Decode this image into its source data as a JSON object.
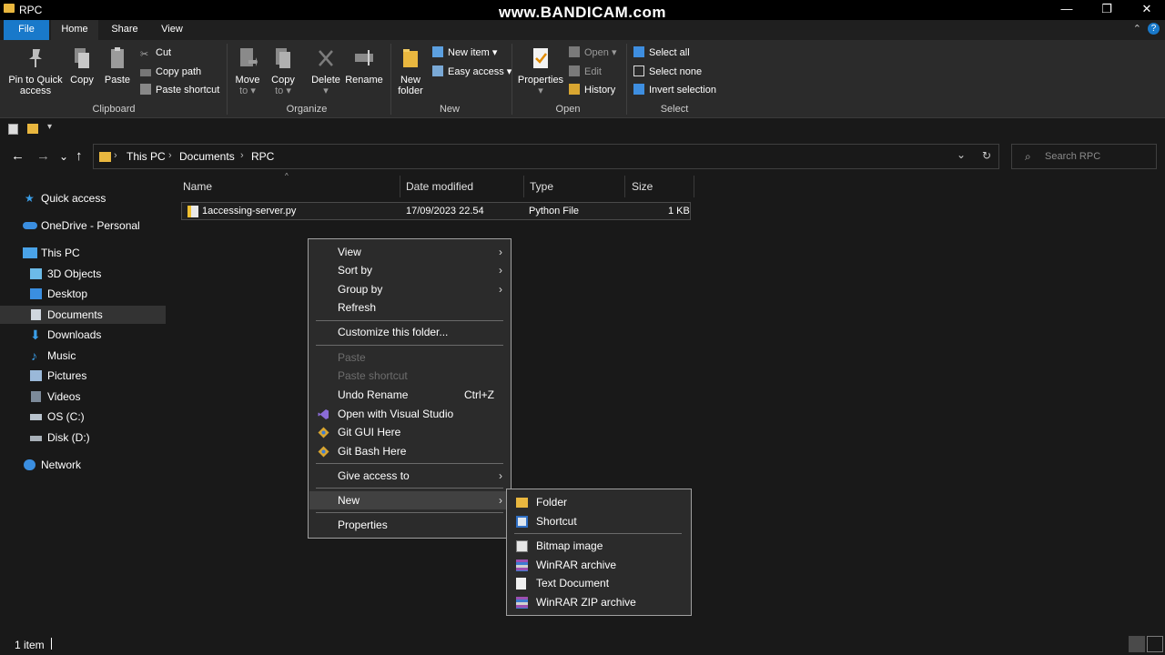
{
  "window": {
    "title": "RPC",
    "watermark": "www.BANDICAM.com",
    "minimize_glyph": "—",
    "restore_glyph": "❐",
    "close_glyph": "✕"
  },
  "tabs": {
    "file": "File",
    "home": "Home",
    "share": "Share",
    "view": "View",
    "collapse_glyph": "⌃",
    "help_glyph": "?"
  },
  "ribbon": {
    "clipboard": {
      "label": "Clipboard",
      "pin_line1": "Pin to Quick",
      "pin_line2": "access",
      "copy": "Copy",
      "paste": "Paste",
      "cut": "Cut",
      "copy_path": "Copy path",
      "paste_shortcut": "Paste shortcut"
    },
    "organize": {
      "label": "Organize",
      "move_line1": "Move",
      "move_line2": "to ▾",
      "copy_line1": "Copy",
      "copy_line2": "to ▾",
      "delete_line1": "Delete",
      "delete_line2": "▾",
      "rename": "Rename"
    },
    "new": {
      "label": "New",
      "folder_line1": "New",
      "folder_line2": "folder",
      "new_item": "New item ▾",
      "easy_access": "Easy access ▾"
    },
    "open": {
      "label": "Open",
      "properties_line1": "Properties",
      "properties_line2": "▾",
      "open": "Open ▾",
      "edit": "Edit",
      "history": "History"
    },
    "select": {
      "label": "Select",
      "select_all": "Select all",
      "select_none": "Select none",
      "invert": "Invert selection"
    }
  },
  "qat": {
    "dropdown_glyph": "▾"
  },
  "address": {
    "back": "←",
    "forward": "→",
    "recent": "⌄",
    "up": "↑",
    "crumbs": [
      "This PC",
      "Documents",
      "RPC"
    ],
    "crumb_sep": "›",
    "dropdown": "⌄",
    "refresh": "↻"
  },
  "search": {
    "placeholder": "Search RPC",
    "glyph": "⌕"
  },
  "nav": {
    "quick_access": "Quick access",
    "onedrive": "OneDrive - Personal",
    "this_pc": "This PC",
    "objects3d": "3D Objects",
    "desktop": "Desktop",
    "documents": "Documents",
    "downloads": "Downloads",
    "music": "Music",
    "pictures": "Pictures",
    "videos": "Videos",
    "os": "OS (C:)",
    "disk": "Disk (D:)",
    "network": "Network"
  },
  "columns": {
    "name": "Name",
    "date": "Date modified",
    "type": "Type",
    "size": "Size",
    "sort_glyph": "^"
  },
  "files": [
    {
      "name": "1accessing-server.py",
      "date": "17/09/2023 22.54",
      "type": "Python File",
      "size": "1 KB"
    }
  ],
  "context_menu": {
    "arrow": "›",
    "view": "View",
    "sort_by": "Sort by",
    "group_by": "Group by",
    "refresh": "Refresh",
    "customize": "Customize this folder...",
    "paste": "Paste",
    "paste_shortcut": "Paste shortcut",
    "undo_rename": "Undo Rename",
    "undo_accel": "Ctrl+Z",
    "open_vs": "Open with Visual Studio",
    "git_gui": "Git GUI Here",
    "git_bash": "Git Bash Here",
    "give_access": "Give access to",
    "new": "New",
    "properties": "Properties"
  },
  "new_submenu": {
    "folder": "Folder",
    "shortcut": "Shortcut",
    "bitmap": "Bitmap image",
    "winrar": "WinRAR archive",
    "text": "Text Document",
    "winrar_zip": "WinRAR ZIP archive"
  },
  "status": {
    "items": "1 item"
  },
  "colors": {
    "accent": "#1979ca",
    "folder": "#e9b73f",
    "menu_bg": "#2b2b2b",
    "window_bg": "#191919"
  }
}
